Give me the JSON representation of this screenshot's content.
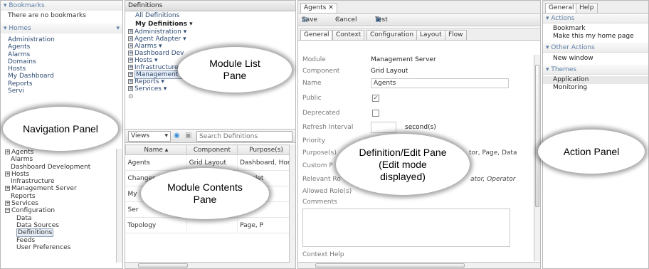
{
  "nav": {
    "bookmarks_header": "Bookmarks",
    "no_bookmarks": "There are no bookmarks",
    "homes_header": "Homes",
    "homes": [
      "Administration",
      "Agents",
      "Alarms",
      "Domains",
      "Hosts",
      "My Dashboard",
      "Reports",
      "Servi"
    ],
    "tree_top": "Agents",
    "tree": [
      {
        "label": "Alarms",
        "indent": 1,
        "plus": false
      },
      {
        "label": "Dashboard Development",
        "indent": 1,
        "plus": false
      },
      {
        "label": "Hosts",
        "indent": 0,
        "plus": true
      },
      {
        "label": "Infrastructure",
        "indent": 1,
        "plus": false
      },
      {
        "label": "Management Server",
        "indent": 0,
        "plus": true
      },
      {
        "label": "Reports",
        "indent": 1,
        "plus": false
      },
      {
        "label": "Services",
        "indent": 0,
        "plus": true
      },
      {
        "label": "Configuration",
        "indent": 0,
        "plus": true
      },
      {
        "label": "Data",
        "indent": 2,
        "plus": false
      },
      {
        "label": "Data Sources",
        "indent": 2,
        "plus": false
      },
      {
        "label": "Definitions",
        "indent": 2,
        "plus": false,
        "selected": true
      },
      {
        "label": "Feeds",
        "indent": 2,
        "plus": false
      },
      {
        "label": "User Preferences",
        "indent": 2,
        "plus": false
      }
    ]
  },
  "modules": {
    "header": "Definitions",
    "all": "All Definitions",
    "mine": "My Definitions ▾",
    "list": [
      "Administration ▾",
      "Agent Adapter ▾",
      "Alarms ▾",
      "Dashboard Dev",
      "Hosts ▾",
      "Infrastructure ▾",
      "Management Server",
      "Reports ▾",
      "Services ▾"
    ],
    "views_label": "Views",
    "search_placeholder": "Search Definitions",
    "columns": [
      "Name ▴",
      "Component",
      "Purpose(s)"
    ],
    "rows": [
      [
        "Agents",
        "Grid Layout",
        "Dashboard, Hom"
      ],
      [
        "Changes O",
        "",
        "Pagelet"
      ],
      [
        "My",
        "",
        "let"
      ],
      [
        "Ser",
        "",
        ""
      ],
      [
        "Topology",
        "",
        "Page, P"
      ]
    ]
  },
  "edit": {
    "tab_title": "Agents",
    "save": "Save",
    "cancel": "Cancel",
    "test": "Test",
    "tabs": [
      "General",
      "Context",
      "Configuration",
      "Layout",
      "Flow"
    ],
    "fields": {
      "module_label": "Module",
      "module_value": "Management Server",
      "component_label": "Component",
      "component_value": "Grid Layout",
      "name_label": "Name",
      "name_value": "Agents",
      "public_label": "Public",
      "deprecated_label": "Deprecated",
      "refresh_label": "Refresh Interval",
      "refresh_unit": "second(s)",
      "priority_label": "Priority",
      "purpose_label": "Purpose(s)",
      "purpose_value": "tor, Page, Data",
      "custom_label": "Custom P",
      "relevant_label": "Relevant Ro",
      "relevant_value": "ator, Operator",
      "allowed_label": "Allowed Role(s)",
      "comments_label": "Comments",
      "context_help_label": "Context Help"
    }
  },
  "actions": {
    "tabs": [
      "General",
      "Help"
    ],
    "actions_header": "Actions",
    "actions": [
      "Bookmark",
      "Make this my home page"
    ],
    "other_header": "Other Actions",
    "other": [
      "New window"
    ],
    "themes_header": "Themes",
    "themes": [
      "Application",
      "Monitoring"
    ]
  },
  "callouts": {
    "navigation": "Navigation Panel",
    "module_list": "Module List\nPane",
    "module_contents": "Module Contents\nPane",
    "edit_pane": "Definition/Edit Pane\n(Edit mode\ndisplayed)",
    "action_panel": "Action Panel"
  }
}
